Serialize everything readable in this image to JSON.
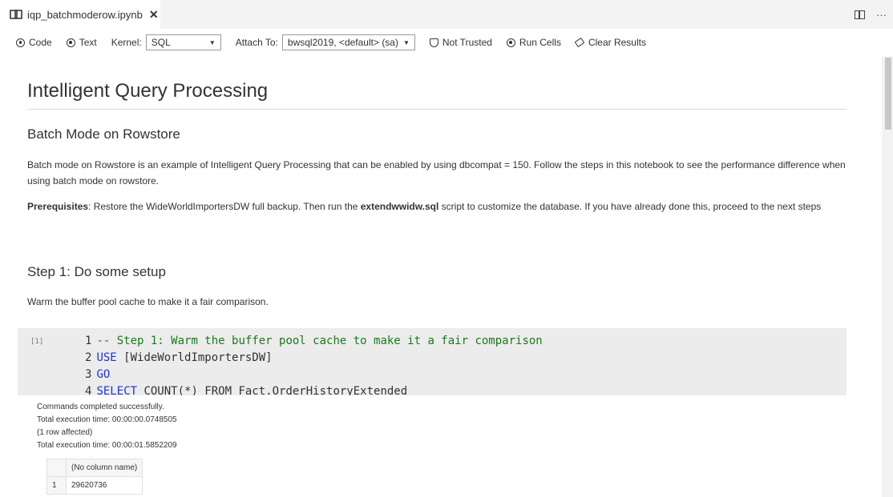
{
  "tab": {
    "title": "iqp_batchmoderow.ipynb",
    "close": "✕"
  },
  "window": {
    "more": "···"
  },
  "toolbar": {
    "code_label": "Code",
    "text_label": "Text",
    "kernel_label": "Kernel:",
    "kernel_value": "SQL",
    "attach_label": "Attach To:",
    "attach_value": "bwsql2019, <default> (sa)",
    "trust_label": "Not Trusted",
    "run_label": "Run Cells",
    "clear_label": "Clear Results"
  },
  "notebook": {
    "title": "Intelligent Query Processing",
    "subtitle": "Batch Mode on Rowstore",
    "intro": "Batch mode on Rowstore is an example of Intelligent Query Processing that can be enabled by using dbcompat = 150. Follow the steps in this notebook to see the performance difference when using batch mode on rowstore.",
    "prereq_label": "Prerequisites",
    "prereq_text_1": ": Restore the WideWorldImportersDW full backup. Then run the ",
    "prereq_script": "extendwwidw.sql",
    "prereq_text_2": " script to customize the database. If you have already done this, proceed to the next steps",
    "step1_title": "Step 1: Do some setup",
    "step1_text": "Warm the buffer pool cache to make it a fair comparison."
  },
  "code_cell": {
    "exec_count": "[1]",
    "lines": [
      {
        "num": "1",
        "text": "-- Step 1: Warm the buffer pool cache to make it a fair comparison"
      },
      {
        "num": "2",
        "kw": "USE",
        "text": " [WideWorldImportersDW]"
      },
      {
        "num": "3",
        "kw": "GO",
        "text": ""
      },
      {
        "num": "4",
        "kw": "SELECT",
        "text": " COUNT(*) FROM Fact.OrderHistoryExtended"
      }
    ]
  },
  "output": {
    "lines": [
      "Commands completed successfully.",
      "Total execution time: 00:00:00.0748505",
      "(1 row affected)",
      "Total execution time: 00:00:01.5852209"
    ],
    "table": {
      "header": "(No column name)",
      "rows": [
        {
          "num": "1",
          "value": "29620736"
        }
      ]
    }
  },
  "colors": {
    "comment": "#1a7a1a",
    "keyword": "#1a34d6",
    "cell_bg": "#ececec"
  }
}
